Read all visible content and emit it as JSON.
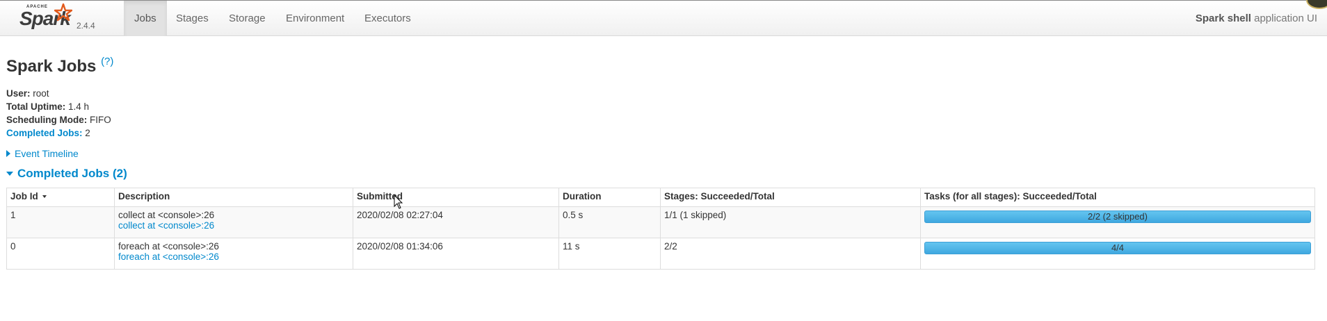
{
  "brand": {
    "apache": "APACHE",
    "name": "Spark",
    "version": "2.4.4"
  },
  "nav": {
    "tabs": [
      {
        "label": "Jobs",
        "active": true
      },
      {
        "label": "Stages"
      },
      {
        "label": "Storage"
      },
      {
        "label": "Environment"
      },
      {
        "label": "Executors"
      }
    ],
    "app_name": "Spark shell",
    "app_suffix": " application UI"
  },
  "page": {
    "title": "Spark Jobs",
    "help": "(?)",
    "summary": {
      "user_label": "User:",
      "user": " root",
      "uptime_label": "Total Uptime:",
      "uptime": " 1.4 h",
      "mode_label": "Scheduling Mode:",
      "mode": " FIFO",
      "completed_label": "Completed Jobs:",
      "completed": " 2"
    },
    "event_timeline": "Event Timeline",
    "completed_section": "Completed Jobs (2)"
  },
  "table": {
    "headers": [
      "Job Id",
      "Description",
      "Submitted",
      "Duration",
      "Stages: Succeeded/Total",
      "Tasks (for all stages): Succeeded/Total"
    ],
    "rows": [
      {
        "id": "1",
        "desc": "collect at <console>:26",
        "desc_link": "collect at <console>:26",
        "submitted": "2020/02/08 02:27:04",
        "duration": "0.5 s",
        "stages": "1/1 (1 skipped)",
        "tasks": "2/2 (2 skipped)",
        "tasks_fraction": 1.0
      },
      {
        "id": "0",
        "desc": "foreach at <console>:26",
        "desc_link": "foreach at <console>:26",
        "submitted": "2020/02/08 01:34:06",
        "duration": "11 s",
        "stages": "2/2",
        "tasks": "4/4",
        "tasks_fraction": 1.0
      }
    ]
  },
  "colors": {
    "accent": "#0088cc",
    "progress": "#5bc0de"
  }
}
